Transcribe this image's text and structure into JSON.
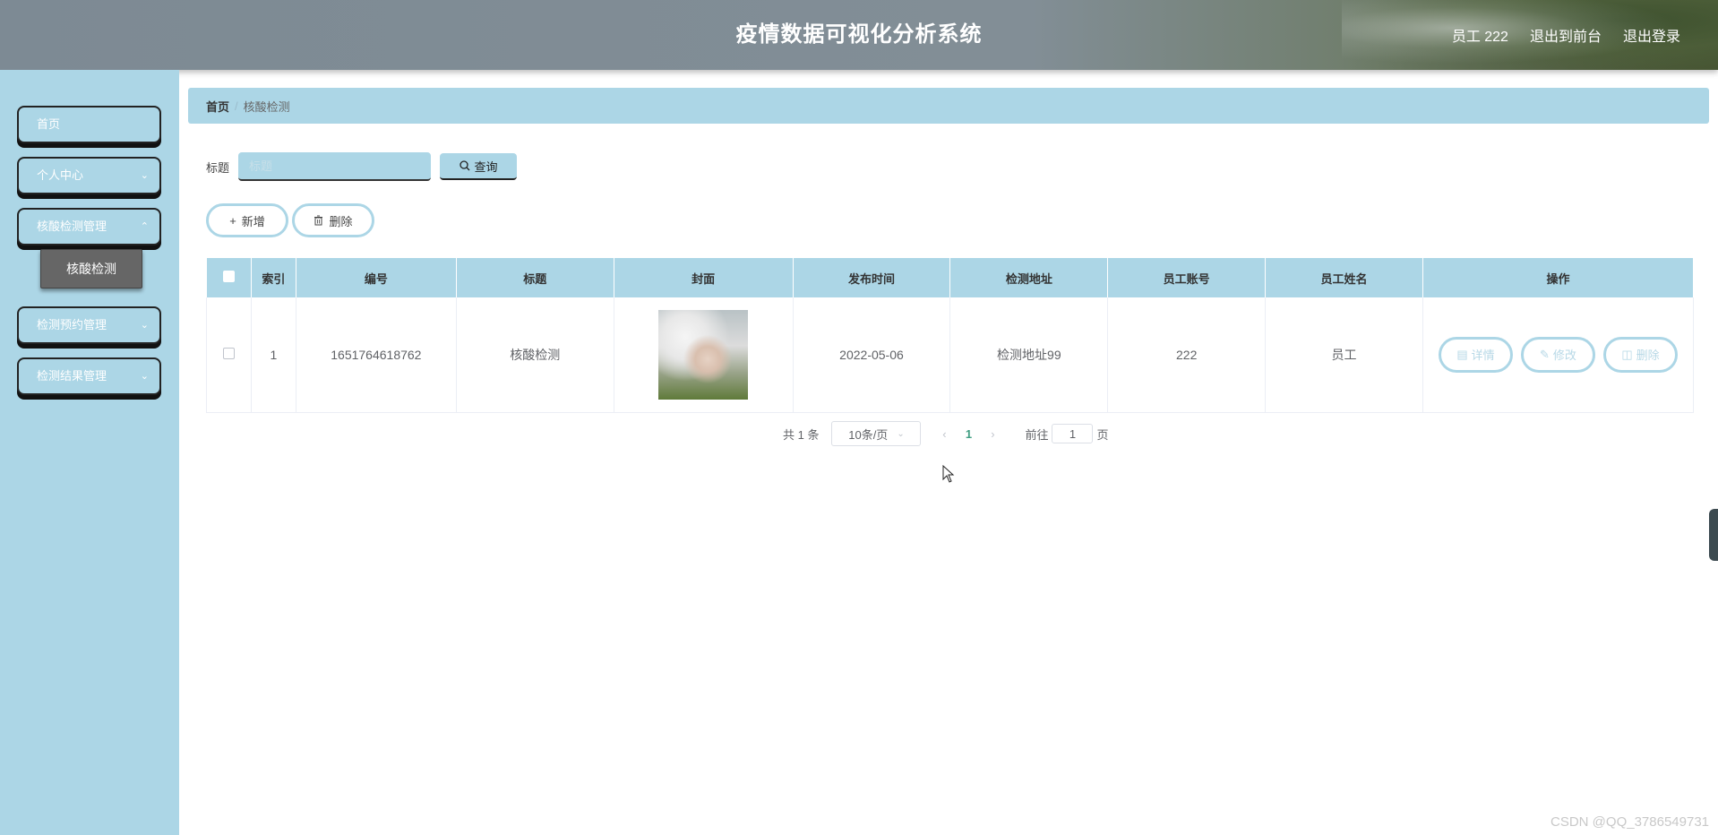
{
  "header": {
    "title": "疫情数据可视化分析系统",
    "user_label": "员工 222",
    "to_front_label": "退出到前台",
    "logout_label": "退出登录"
  },
  "sidebar": {
    "items": [
      {
        "label": "首页",
        "has_children": false
      },
      {
        "label": "个人中心",
        "has_children": true
      },
      {
        "label": "核酸检测管理",
        "has_children": true
      },
      {
        "label": "检测预约管理",
        "has_children": true
      },
      {
        "label": "检测结果管理",
        "has_children": true
      }
    ],
    "submenu_active": "核酸检测"
  },
  "breadcrumb": {
    "home": "首页",
    "current": "核酸检测"
  },
  "search": {
    "label": "标题",
    "placeholder": "标题",
    "value": "",
    "query_label": "查询"
  },
  "actions": {
    "add_label": "新增",
    "delete_label": "删除"
  },
  "table": {
    "columns": [
      "索引",
      "编号",
      "标题",
      "封面",
      "发布时间",
      "检测地址",
      "员工账号",
      "员工姓名",
      "操作"
    ],
    "rows": [
      {
        "index": "1",
        "number": "1651764618762",
        "title": "核酸检测",
        "publish_time": "2022-05-06",
        "address": "检测地址99",
        "account": "222",
        "name": "员工"
      }
    ],
    "op_detail": "详情",
    "op_edit": "修改",
    "op_delete": "删除"
  },
  "pagination": {
    "total_label": "共 1 条",
    "page_size_label": "10条/页",
    "current_page": "1",
    "goto_label": "前往",
    "goto_value": "1",
    "page_suffix": "页"
  },
  "watermark": "CSDN @QQ_3786549731",
  "colors": {
    "accent": "#acd6e6",
    "submenu_active": "#666666",
    "page_active": "#409e82"
  }
}
